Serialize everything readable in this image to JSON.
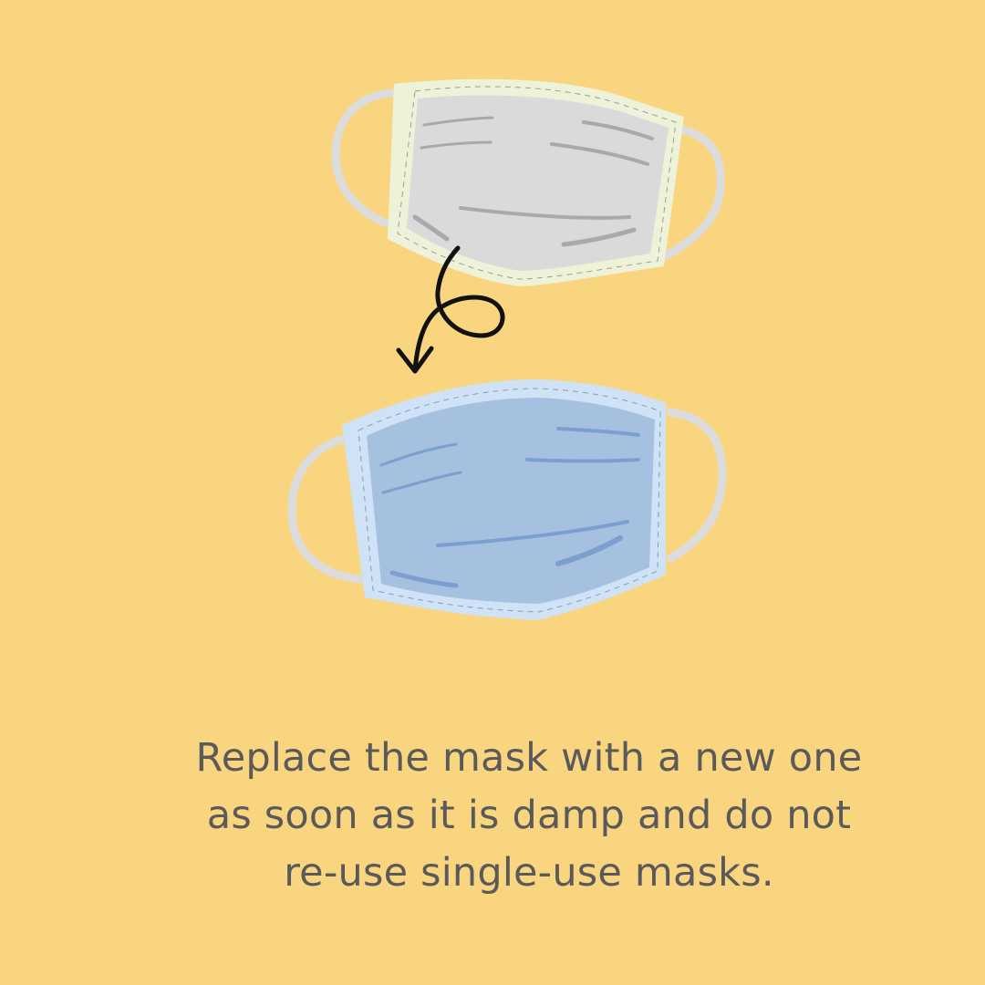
{
  "colors": {
    "background": "#fad580",
    "text": "#5a5a5a",
    "old_mask_fabric": "#dadada",
    "old_mask_trim": "#eef2d8",
    "new_mask_fabric": "#a6c1e0",
    "new_mask_trim": "#cfe2f6",
    "ear_loop": "#dcdcdc",
    "arrow": "#111111"
  },
  "icons": [
    "used-mask-icon",
    "curly-arrow-icon",
    "new-mask-icon"
  ],
  "caption": {
    "lines": [
      "Replace the mask with a new one",
      "as soon as it is damp and do not",
      "re-use single-use masks."
    ]
  }
}
